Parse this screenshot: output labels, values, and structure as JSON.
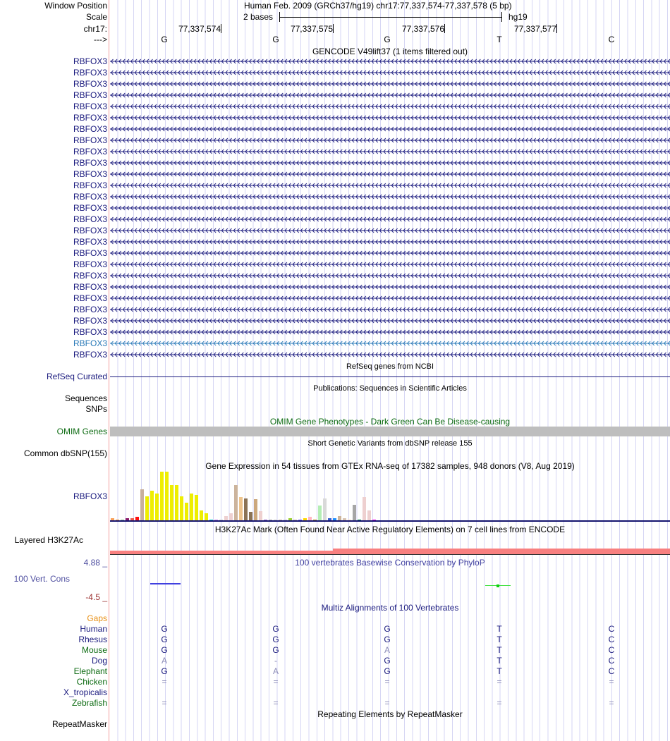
{
  "header": {
    "window_position_label": "Window Position",
    "window_position_value": "Human Feb. 2009 (GRCh37/hg19)   chr17:77,337,574-77,337,578 (5 bp)",
    "scale_label": "Scale",
    "scale_value": "2 bases",
    "scale_assembly": "hg19",
    "chrom_label": "chr17:",
    "positions": [
      "77,337,574",
      "77,337,575",
      "77,337,576",
      "77,337,577"
    ],
    "strand_label": "--->",
    "bases": [
      "G",
      "G",
      "G",
      "T",
      "C"
    ]
  },
  "gencode": {
    "title": "GENCODE V49lift37 (1 items filtered out)",
    "rows": [
      "RBFOX3",
      "RBFOX3",
      "RBFOX3",
      "RBFOX3",
      "RBFOX3",
      "RBFOX3",
      "RBFOX3",
      "RBFOX3",
      "RBFOX3",
      "RBFOX3",
      "RBFOX3",
      "RBFOX3",
      "RBFOX3",
      "RBFOX3",
      "RBFOX3",
      "RBFOX3",
      "RBFOX3",
      "RBFOX3",
      "RBFOX3",
      "RBFOX3",
      "RBFOX3",
      "RBFOX3",
      "RBFOX3",
      "RBFOX3",
      "RBFOX3",
      "RBFOX3",
      "RBFOX3"
    ],
    "highlight_row_index": 25,
    "color": "#1a1a7e",
    "highlight_color": "#2a7ab8"
  },
  "refseq": {
    "title": "RefSeq genes from NCBI",
    "label": "RefSeq Curated"
  },
  "publications": {
    "title": "Publications: Sequences in Scientific Articles",
    "labels": [
      "Sequences",
      "SNPs"
    ]
  },
  "omim": {
    "title": "OMIM Gene Phenotypes - Dark Green Can Be Disease-causing",
    "label": "OMIM Genes"
  },
  "dbsnp": {
    "title": "Short Genetic Variants from dbSNP release 155",
    "label": "Common dbSNP(155)"
  },
  "gtex": {
    "title": "Gene Expression in 54 tissues from GTEx RNA-seq of 17382 samples, 948 donors (V8, Aug 2019)",
    "label": "RBFOX3",
    "relative_values": [
      0.04,
      0.02,
      0.01,
      0.04,
      0.04,
      0.07,
      0.64,
      0.49,
      0.61,
      0.55,
      1.0,
      1.0,
      0.73,
      0.73,
      0.49,
      0.36,
      0.55,
      0.52,
      0.2,
      0.15,
      0.02,
      0.01,
      0.0,
      0.08,
      0.15,
      0.73,
      0.48,
      0.45,
      0.18,
      0.44,
      0.19,
      0.01,
      0.0,
      0.0,
      0.01,
      0.0,
      0.05,
      0.01,
      0.02,
      0.05,
      0.07,
      0.01,
      0.31,
      0.45,
      0.04,
      0.04,
      0.08,
      0.04,
      0.02,
      0.32,
      0.02,
      0.48,
      0.21,
      0.01
    ],
    "colors": [
      "#f9a05a",
      "#f0902a",
      "#8fbc8f",
      "#8b1a6b",
      "#ee5a4a",
      "#ff1010",
      "#c8b09c",
      "#eeee00",
      "#eeee00",
      "#eeee00",
      "#eeee00",
      "#eeee00",
      "#eeee00",
      "#eeee00",
      "#eeee00",
      "#eeee00",
      "#eeee00",
      "#eeee00",
      "#eeee00",
      "#eeee00",
      "#00cccc",
      "#cc88ee",
      "#cccccc",
      "#eed0d0",
      "#eed0d0",
      "#ccb49c",
      "#eec48c",
      "#8b7355",
      "#8b7355",
      "#cca87c",
      "#eed0d0",
      "#9966cc",
      "#aaaaaa",
      "#cccccc",
      "#ccbbaa",
      "#cccccc",
      "#9acd32",
      "#ccbbaa",
      "#7b68ee",
      "#ffd700",
      "#ffb6c1",
      "#b8960c",
      "#b4eeb4",
      "#d9d9d9",
      "#3a5fcd",
      "#1e90ff",
      "#ccb49c",
      "#d9c4b4",
      "#ffdab9",
      "#a6a6a6",
      "#008b45",
      "#eed0d0",
      "#eed0d0",
      "#ee00ee"
    ]
  },
  "h3k27ac": {
    "title": "H3K27Ac Mark (Often Found Near Active Regulatory Elements) on 7 cell lines from ENCODE",
    "label": "Layered H3K27Ac"
  },
  "phylop": {
    "title": "100 vertebrates Basewise Conservation by PhyloP",
    "label": "100 Vert. Cons",
    "max_label": "4.88 _",
    "min_label": "-4.5 _"
  },
  "multiz": {
    "title": "Multiz Alignments of 100 Vertebrates",
    "gaps_label": "Gaps",
    "species": [
      {
        "name": "Human",
        "color": "navy",
        "bases": [
          "G",
          "G",
          "G",
          "T",
          "C"
        ],
        "light": [
          false,
          false,
          false,
          false,
          false
        ]
      },
      {
        "name": "Rhesus",
        "color": "navy",
        "bases": [
          "G",
          "G",
          "G",
          "T",
          "C"
        ],
        "light": [
          false,
          false,
          false,
          false,
          false
        ]
      },
      {
        "name": "Mouse",
        "color": "green",
        "bases": [
          "G",
          "G",
          "A",
          "T",
          "C"
        ],
        "light": [
          false,
          false,
          true,
          false,
          false
        ]
      },
      {
        "name": "Dog",
        "color": "navy",
        "bases": [
          "A",
          "-",
          "G",
          "T",
          "C"
        ],
        "light": [
          true,
          true,
          false,
          false,
          false
        ]
      },
      {
        "name": "Elephant",
        "color": "green",
        "bases": [
          "G",
          "A",
          "G",
          "T",
          "C"
        ],
        "light": [
          false,
          true,
          false,
          false,
          false
        ]
      },
      {
        "name": "Chicken",
        "color": "green",
        "bases": [
          "=",
          "=",
          "=",
          "=",
          "="
        ],
        "light": [
          true,
          true,
          true,
          true,
          true
        ]
      },
      {
        "name": "X_tropicalis",
        "color": "navy",
        "bases": [
          "",
          "",
          "",
          "",
          ""
        ],
        "light": [
          false,
          false,
          false,
          false,
          false
        ]
      },
      {
        "name": "Zebrafish",
        "color": "green",
        "bases": [
          "=",
          "=",
          "=",
          "=",
          "="
        ],
        "light": [
          true,
          true,
          true,
          true,
          true
        ]
      }
    ]
  },
  "repeatmasker": {
    "title": "Repeating Elements by RepeatMasker",
    "label": "RepeatMasker"
  }
}
